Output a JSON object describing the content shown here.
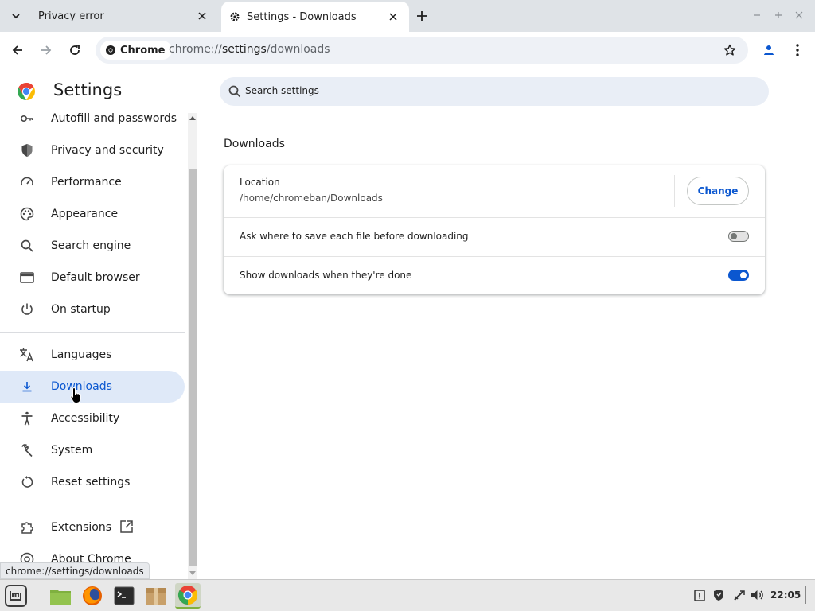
{
  "tabs": [
    {
      "title": "Privacy error",
      "active": false
    },
    {
      "title": "Settings - Downloads",
      "active": true
    }
  ],
  "toolbar": {
    "chip_label": "Chrome",
    "url_dim": "chrome://",
    "url_main": "settings",
    "url_rest": "/downloads"
  },
  "settings": {
    "title": "Settings",
    "search_placeholder": "Search settings"
  },
  "sidebar": {
    "items": [
      {
        "label": "Autofill and passwords",
        "icon": "key-icon"
      },
      {
        "label": "Privacy and security",
        "icon": "shield-icon"
      },
      {
        "label": "Performance",
        "icon": "speedometer-icon"
      },
      {
        "label": "Appearance",
        "icon": "palette-icon"
      },
      {
        "label": "Search engine",
        "icon": "search-icon"
      },
      {
        "label": "Default browser",
        "icon": "browser-window-icon"
      },
      {
        "label": "On startup",
        "icon": "power-icon"
      },
      {
        "label": "Languages",
        "icon": "translate-icon"
      },
      {
        "label": "Downloads",
        "icon": "download-icon",
        "selected": true
      },
      {
        "label": "Accessibility",
        "icon": "accessibility-icon"
      },
      {
        "label": "System",
        "icon": "wrench-icon"
      },
      {
        "label": "Reset settings",
        "icon": "reset-icon"
      },
      {
        "label": "Extensions",
        "icon": "puzzle-icon"
      },
      {
        "label": "About Chrome",
        "icon": "chrome-icon"
      }
    ]
  },
  "downloads": {
    "section_title": "Downloads",
    "location_label": "Location",
    "location_path": "/home/chromeban/Downloads",
    "change_label": "Change",
    "ask_label": "Ask where to save each file before downloading",
    "ask_enabled": false,
    "show_label": "Show downloads when they're done",
    "show_enabled": true
  },
  "status_bubble": "chrome://settings/downloads",
  "taskbar": {
    "apps": [
      "mint-menu-icon",
      "files-icon",
      "firefox-icon",
      "terminal-icon",
      "archive-icon",
      "chrome-icon"
    ],
    "clock": "22:05"
  },
  "colors": {
    "accent": "#0b57d0",
    "selected_bg": "#dfe9f8",
    "search_bg": "#e9eef6"
  }
}
